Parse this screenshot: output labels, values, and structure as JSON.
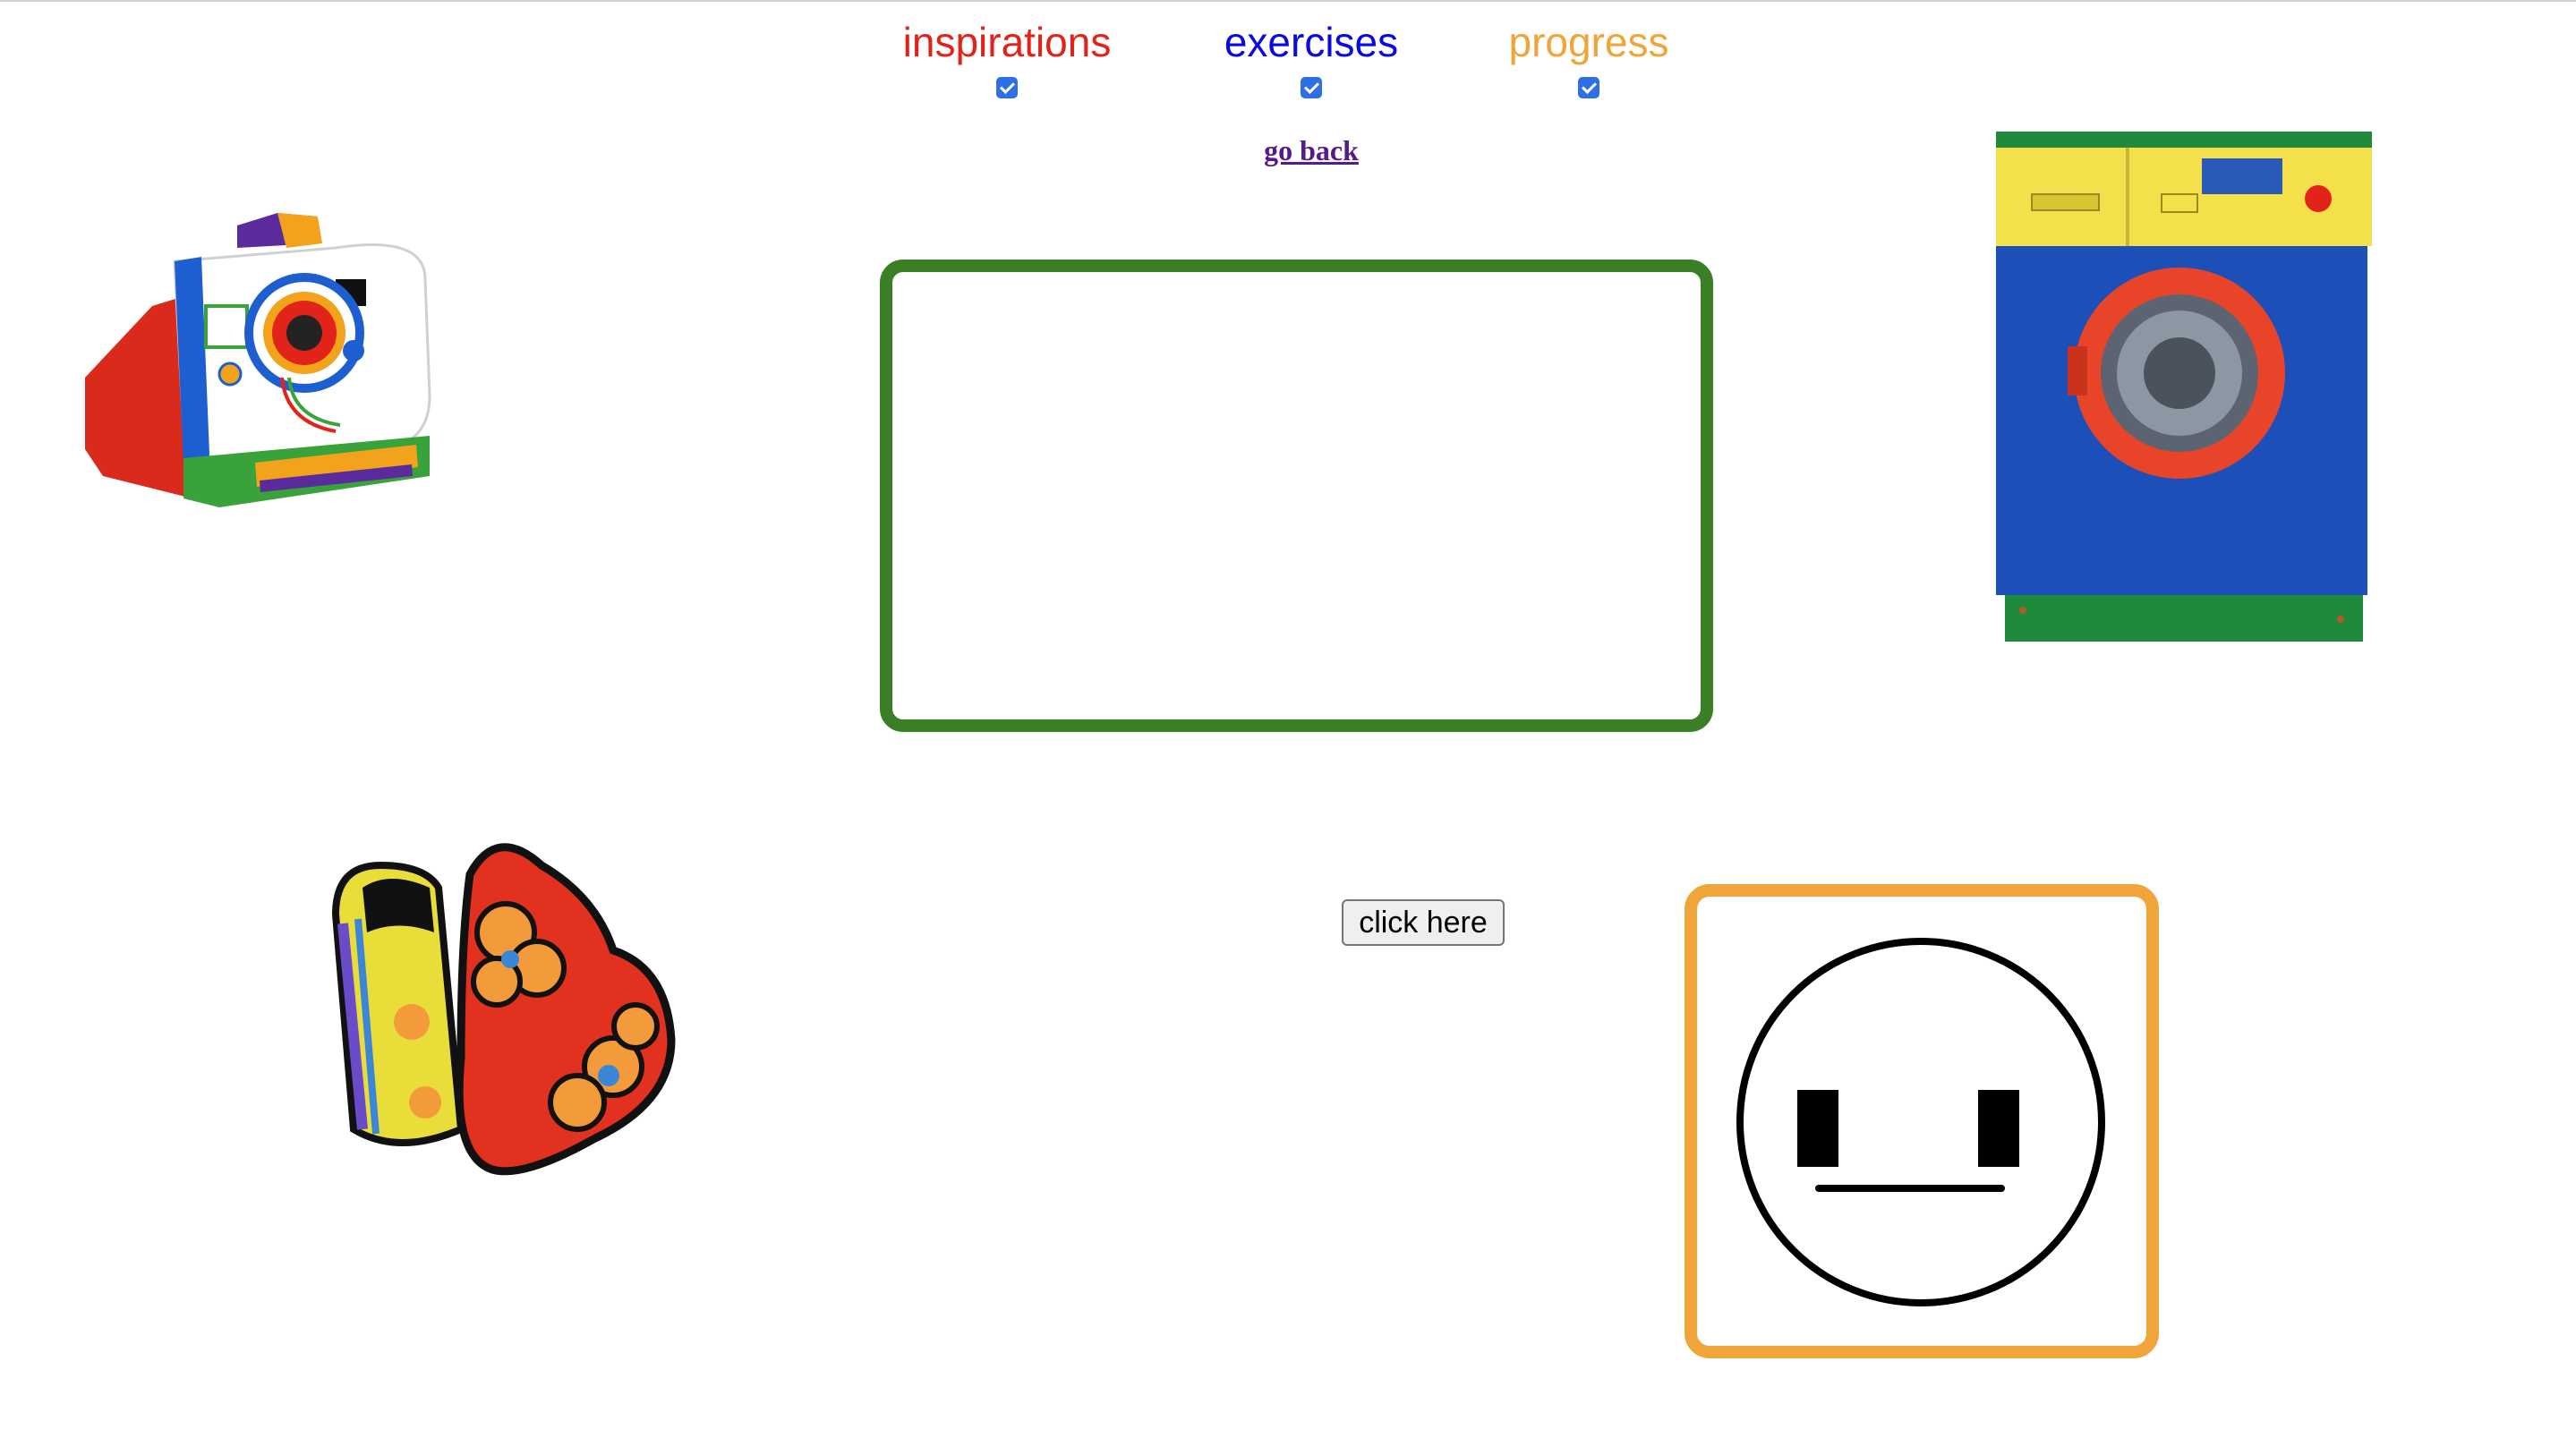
{
  "nav": {
    "items": [
      {
        "label": "inspirations",
        "color": "#e2231a",
        "checked": true
      },
      {
        "label": "exercises",
        "color": "#0a0ae0",
        "checked": true
      },
      {
        "label": "progress",
        "color": "#f0a53a",
        "checked": true
      }
    ]
  },
  "go_back_label": "go back",
  "button_label": "click here",
  "colors": {
    "green_box_border": "#3a7f26",
    "face_box_border": "#f0a53a",
    "link": "#551a8b"
  },
  "images": {
    "camera": "instant-camera",
    "washer": "washing-machine",
    "heart_box": "heart-shaped-box",
    "face": "neutral-face"
  }
}
